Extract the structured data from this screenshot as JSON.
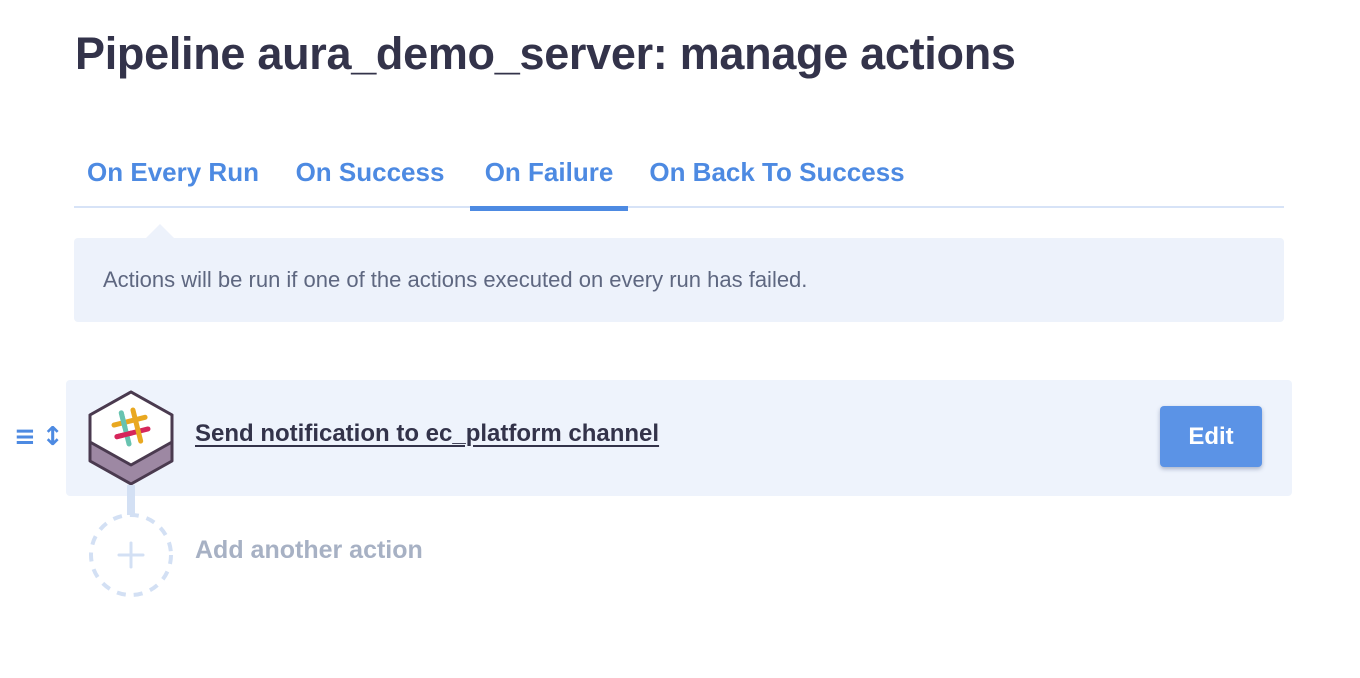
{
  "page": {
    "title": "Pipeline aura_demo_server: manage actions"
  },
  "tabs": [
    {
      "label": "On Every Run",
      "active": false
    },
    {
      "label": "On Success",
      "active": false
    },
    {
      "label": "On Failure",
      "active": true
    },
    {
      "label": "On Back To Success",
      "active": false
    }
  ],
  "info": {
    "text": "Actions will be run if one of the actions executed on every run has failed."
  },
  "actions": [
    {
      "title": "Send notification to ec_platform channel",
      "icon": "slack-icon",
      "edit_label": "Edit"
    }
  ],
  "add_action": {
    "label": "Add another action",
    "icon": "plus-icon"
  },
  "drag_handle": {
    "icons": [
      "hamburger-icon",
      "vertical-arrows-icon"
    ],
    "glyphs": [
      "≡",
      "↕"
    ]
  },
  "colors": {
    "accent": "#4d8ae2",
    "button": "#5b93e6",
    "title": "#33334a",
    "info_bg": "#edf2fb",
    "row_bg": "#eef3fc",
    "muted": "#a7b1c4",
    "hex_fill": "#9d88a3",
    "hex_border": "#4a3a4f"
  }
}
